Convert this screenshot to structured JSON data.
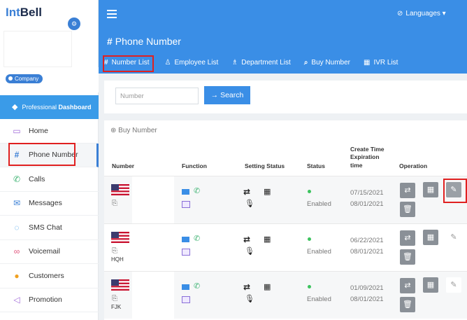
{
  "brand": {
    "int": "Int",
    "bell": "Bell"
  },
  "sidebar": {
    "company_label": "Company",
    "pro_dashboard": {
      "prefix": "Professional",
      "bold": "Dashboard"
    },
    "items": [
      {
        "label": "Home",
        "icon": "monitor-icon"
      },
      {
        "label": "Phone Number",
        "icon": "hash-icon"
      },
      {
        "label": "Calls",
        "icon": "phone-icon"
      },
      {
        "label": "Messages",
        "icon": "envelope-icon"
      },
      {
        "label": "SMS Chat",
        "icon": "chat-icon"
      },
      {
        "label": "Voicemail",
        "icon": "voicemail-icon"
      },
      {
        "label": "Customers",
        "icon": "user-icon"
      },
      {
        "label": "Promotion",
        "icon": "send-icon"
      }
    ]
  },
  "header": {
    "languages": "Languages",
    "page_title": "Phone Number",
    "tabs": [
      {
        "label": "Number List"
      },
      {
        "label": "Employee List"
      },
      {
        "label": "Department List"
      },
      {
        "label": "Buy Number"
      },
      {
        "label": "IVR List"
      }
    ]
  },
  "search": {
    "placeholder": "Number",
    "button": "Search"
  },
  "table": {
    "buy_link": "Buy Number",
    "headers": {
      "number": "Number",
      "function": "Function",
      "setting_status": "Setting Status",
      "status": "Status",
      "create_time_line1": "Create Time",
      "create_time_line2": "Expiration",
      "create_time_line3": "time",
      "operation": "Operation"
    },
    "rows": [
      {
        "tag": "",
        "status": "Enabled",
        "created": "07/15/2021",
        "expires": "08/01/2021"
      },
      {
        "tag": "HQH",
        "status": "Enabled",
        "created": "06/22/2021",
        "expires": "08/01/2021"
      },
      {
        "tag": "FJK",
        "status": "Enabled",
        "created": "01/09/2021",
        "expires": "08/01/2021"
      }
    ]
  },
  "colors": {
    "primary": "#3a8ee6",
    "highlight": "#e02020",
    "enabled": "#3cc35e"
  }
}
